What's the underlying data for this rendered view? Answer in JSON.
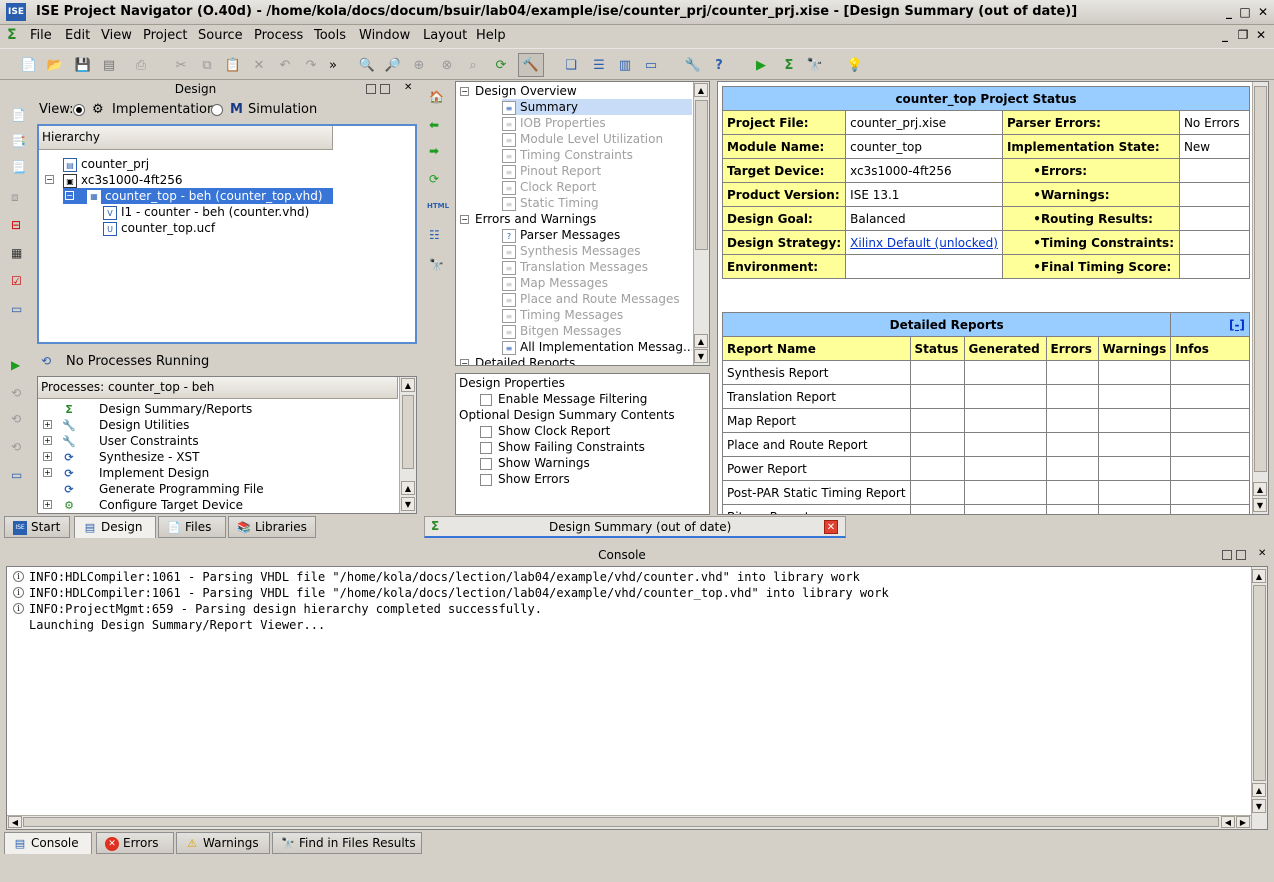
{
  "window": {
    "title": "ISE Project Navigator (O.40d) - /home/kola/docs/docum/bsuir/lab04/example/ise/counter_prj/counter_prj.xise - [Design Summary (out of date)]"
  },
  "menu": [
    "File",
    "Edit",
    "View",
    "Project",
    "Source",
    "Process",
    "Tools",
    "Window",
    "Layout",
    "Help"
  ],
  "design_panel": {
    "title": "Design",
    "view_label": "View:",
    "impl_label": "Implementation",
    "sim_label": "Simulation",
    "hierarchy_header": "Hierarchy",
    "tree": [
      {
        "label": "counter_prj",
        "depth": 0
      },
      {
        "label": "xc3s1000-4ft256",
        "depth": 0
      },
      {
        "label": "counter_top - beh (counter_top.vhd)",
        "depth": 1,
        "selected": true
      },
      {
        "label": "I1 - counter - beh (counter.vhd)",
        "depth": 2
      },
      {
        "label": "counter_top.ucf",
        "depth": 2
      }
    ],
    "status": "No Processes Running",
    "processes_header": "Processes: counter_top - beh",
    "processes": [
      {
        "label": "Design Summary/Reports",
        "expandable": false
      },
      {
        "label": "Design Utilities",
        "expandable": true
      },
      {
        "label": "User Constraints",
        "expandable": true
      },
      {
        "label": "Synthesize - XST",
        "expandable": true
      },
      {
        "label": "Implement Design",
        "expandable": true
      },
      {
        "label": "Generate Programming File",
        "expandable": false
      },
      {
        "label": "Configure Target Device",
        "expandable": true
      }
    ],
    "tabs": [
      "Start",
      "Design",
      "Files",
      "Libraries"
    ]
  },
  "overview_tree": {
    "items": [
      {
        "label": "Design Overview",
        "depth": 0,
        "gray": false
      },
      {
        "label": "Summary",
        "depth": 1,
        "gray": false,
        "selected": true
      },
      {
        "label": "IOB Properties",
        "depth": 1,
        "gray": true
      },
      {
        "label": "Module Level Utilization",
        "depth": 1,
        "gray": true
      },
      {
        "label": "Timing Constraints",
        "depth": 1,
        "gray": true
      },
      {
        "label": "Pinout Report",
        "depth": 1,
        "gray": true
      },
      {
        "label": "Clock Report",
        "depth": 1,
        "gray": true
      },
      {
        "label": "Static Timing",
        "depth": 1,
        "gray": true
      },
      {
        "label": "Errors and Warnings",
        "depth": 0,
        "gray": false
      },
      {
        "label": "Parser Messages",
        "depth": 1,
        "gray": false
      },
      {
        "label": "Synthesis Messages",
        "depth": 1,
        "gray": true
      },
      {
        "label": "Translation Messages",
        "depth": 1,
        "gray": true
      },
      {
        "label": "Map Messages",
        "depth": 1,
        "gray": true
      },
      {
        "label": "Place and Route Messages",
        "depth": 1,
        "gray": true
      },
      {
        "label": "Timing Messages",
        "depth": 1,
        "gray": true
      },
      {
        "label": "Bitgen Messages",
        "depth": 1,
        "gray": true
      },
      {
        "label": "All Implementation Messag...",
        "depth": 1,
        "gray": false
      },
      {
        "label": "Detailed Reports",
        "depth": 0,
        "gray": false
      }
    ]
  },
  "design_properties": {
    "title": "Design Properties",
    "enable_filter": "Enable Message Filtering",
    "optional_title": "Optional Design Summary Contents",
    "options": [
      "Show Clock Report",
      "Show Failing Constraints",
      "Show Warnings",
      "Show Errors"
    ]
  },
  "project_status": {
    "title": "counter_top Project Status",
    "rows": [
      {
        "k1": "Project File:",
        "v1": "counter_prj.xise",
        "k2": "Parser Errors:",
        "v2": "No Errors"
      },
      {
        "k1": "Module Name:",
        "v1": "counter_top",
        "k2": "Implementation State:",
        "v2": "New"
      },
      {
        "k1": "Target Device:",
        "v1": "xc3s1000-4ft256",
        "k2": "Errors:",
        "v2": ""
      },
      {
        "k1": "Product Version:",
        "v1": "ISE 13.1",
        "k2": "Warnings:",
        "v2": ""
      },
      {
        "k1": "Design Goal:",
        "v1": "Balanced",
        "k2": "Routing Results:",
        "v2": ""
      },
      {
        "k1": "Design Strategy:",
        "v1": "Xilinx Default (unlocked)",
        "k2": "Timing Constraints:",
        "v2": ""
      },
      {
        "k1": "Environment:",
        "v1": "",
        "k2": "Final Timing Score:",
        "v2": ""
      }
    ]
  },
  "detailed_reports": {
    "title": "Detailed Reports",
    "collapse": "[-]",
    "columns": [
      "Report Name",
      "Status",
      "Generated",
      "Errors",
      "Warnings",
      "Infos"
    ],
    "rows": [
      "Synthesis Report",
      "Translation Report",
      "Map Report",
      "Place and Route Report",
      "Power Report",
      "Post-PAR Static Timing Report",
      "Bitgen Report"
    ]
  },
  "doc_tab": {
    "label": "Design Summary (out of date)"
  },
  "console": {
    "title": "Console",
    "lines": [
      {
        "info": true,
        "text": "INFO:HDLCompiler:1061 - Parsing VHDL file \"/home/kola/docs/lection/lab04/example/vhd/counter.vhd\" into library work"
      },
      {
        "info": true,
        "text": "INFO:HDLCompiler:1061 - Parsing VHDL file \"/home/kola/docs/lection/lab04/example/vhd/counter_top.vhd\" into library work"
      },
      {
        "info": true,
        "text": "INFO:ProjectMgmt:659 - Parsing design hierarchy completed successfully."
      },
      {
        "info": false,
        "text": "Launching Design Summary/Report Viewer..."
      }
    ],
    "tabs": [
      "Console",
      "Errors",
      "Warnings",
      "Find in Files Results"
    ]
  },
  "colors": {
    "selection": "#3875d7",
    "status_key": "#ffff99",
    "report_header": "#99ccff"
  }
}
